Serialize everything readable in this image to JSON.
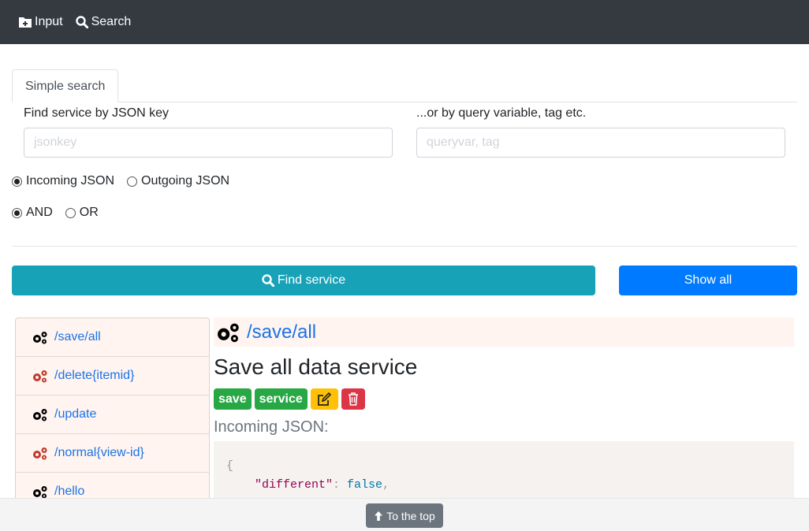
{
  "nav": {
    "input_label": "Input",
    "search_label": "Search",
    "input_icon": "folder-plus-icon",
    "search_icon": "search-icon"
  },
  "tabs": [
    {
      "label": "Simple search",
      "active": true
    }
  ],
  "search": {
    "json_key_label": "Find service by JSON key",
    "json_key_placeholder": "jsonkey",
    "query_label": "...or by query variable, tag etc.",
    "query_placeholder": "queryvar, tag"
  },
  "direction": {
    "options": [
      {
        "label": "Incoming JSON",
        "checked": true
      },
      {
        "label": "Outgoing JSON",
        "checked": false
      }
    ]
  },
  "logic": {
    "options": [
      {
        "label": "AND",
        "checked": true
      },
      {
        "label": "OR",
        "checked": false
      }
    ]
  },
  "buttons": {
    "find_label": "Find service",
    "show_all_label": "Show all",
    "to_top_label": "To the top"
  },
  "colors": {
    "navbar": "#343a40",
    "find_button": "#17a2b8",
    "show_all_button": "#007bff",
    "link": "#1a73e8",
    "badge_green": "#28a745",
    "badge_yellow": "#ffc107",
    "badge_red": "#dc3545",
    "icon_black": "#000000",
    "icon_red": "#c0392b"
  },
  "services": [
    {
      "path": "/save/all",
      "icon_color": "black"
    },
    {
      "path": "/delete{itemid}",
      "icon_color": "red"
    },
    {
      "path": "/update",
      "icon_color": "black"
    },
    {
      "path": "/normal{view-id}",
      "icon_color": "red"
    },
    {
      "path": "/hello",
      "icon_color": "black"
    },
    {
      "path": "",
      "icon_color": "black"
    }
  ],
  "detail": {
    "path": "/save/all",
    "title": "Save all data service",
    "tags": [
      "save",
      "service"
    ],
    "edit_icon": "edit-icon",
    "delete_icon": "trash-icon",
    "incoming_label": "Incoming JSON:",
    "code_open": "{",
    "code_key": "\"different\"",
    "code_colon": ": ",
    "code_value": "false",
    "code_comma": ","
  }
}
